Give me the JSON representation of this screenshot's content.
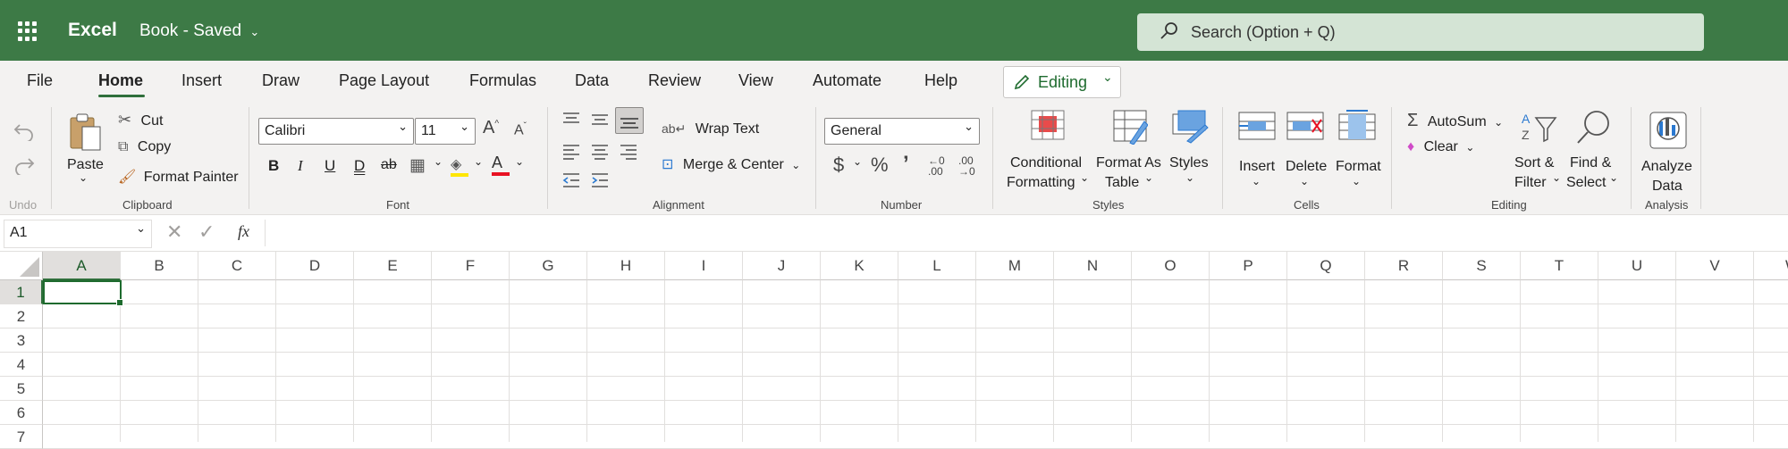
{
  "titlebar": {
    "app": "Excel",
    "doc": "Book - Saved",
    "search_placeholder": "Search (Option + Q)"
  },
  "menubar": {
    "tabs": [
      "File",
      "Home",
      "Insert",
      "Draw",
      "Page Layout",
      "Formulas",
      "Data",
      "Review",
      "View",
      "Automate",
      "Help"
    ],
    "active": "Home",
    "editing_label": "Editing"
  },
  "ribbon": {
    "undo": {
      "label": "Undo"
    },
    "clipboard": {
      "label": "Clipboard",
      "paste": "Paste",
      "cut": "Cut",
      "copy": "Copy",
      "format_painter": "Format Painter"
    },
    "font": {
      "label": "Font",
      "family": "Calibri",
      "size": "11"
    },
    "alignment": {
      "label": "Alignment",
      "wrap": "Wrap Text",
      "merge": "Merge & Center"
    },
    "number": {
      "label": "Number",
      "format": "General"
    },
    "styles": {
      "label": "Styles",
      "conditional_1": "Conditional",
      "conditional_2": "Formatting",
      "table_1": "Format As",
      "table_2": "Table",
      "styles": "Styles"
    },
    "cells": {
      "label": "Cells",
      "insert": "Insert",
      "delete": "Delete",
      "format": "Format"
    },
    "editing": {
      "label": "Editing",
      "autosum": "AutoSum",
      "clear": "Clear",
      "sort_1": "Sort &",
      "sort_2": "Filter",
      "find_1": "Find &",
      "find_2": "Select"
    },
    "analysis": {
      "label": "Analysis",
      "analyze_1": "Analyze",
      "analyze_2": "Data"
    }
  },
  "formulabar": {
    "namebox": "A1",
    "fx": "fx"
  },
  "grid": {
    "columns": [
      "A",
      "B",
      "C",
      "D",
      "E",
      "F",
      "G",
      "H",
      "I",
      "J",
      "K",
      "L",
      "M",
      "N",
      "O",
      "P",
      "Q",
      "R",
      "S",
      "T",
      "U",
      "V",
      "W"
    ],
    "rows": [
      "1",
      "2",
      "3",
      "4",
      "5",
      "6",
      "7"
    ],
    "active_cell": "A1"
  },
  "colors": {
    "brand": "#3d7a46",
    "accent": "#2f6f3b"
  }
}
